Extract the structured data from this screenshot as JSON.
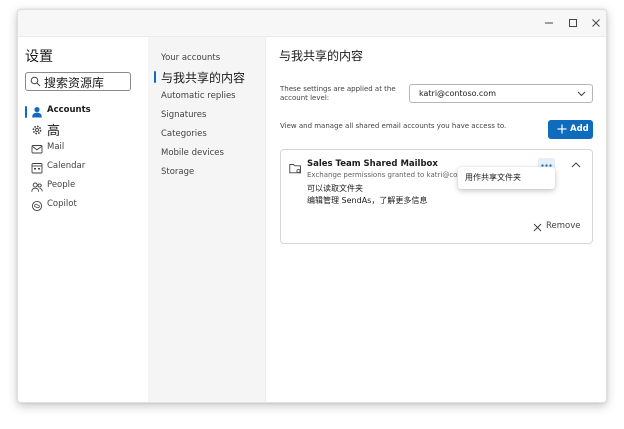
{
  "sidebar": {
    "title": "设置",
    "search": {
      "value": "搜索资源库"
    },
    "items": [
      {
        "label": "Accounts",
        "icon": "person-icon",
        "active": true
      },
      {
        "label": "高",
        "icon": "gear-icon"
      },
      {
        "label": "Mail",
        "icon": "mail-icon"
      },
      {
        "label": "Calendar",
        "icon": "calendar-icon"
      },
      {
        "label": "People",
        "icon": "people-icon"
      },
      {
        "label": "Copilot",
        "icon": "copilot-icon"
      }
    ]
  },
  "submenu": {
    "items": [
      {
        "label": "Your accounts"
      },
      {
        "label": "与我共享的内容",
        "active": true
      },
      {
        "label": "Automatic replies"
      },
      {
        "label": "Signatures"
      },
      {
        "label": "Categories"
      },
      {
        "label": "Mobile devices"
      },
      {
        "label": "Storage"
      }
    ]
  },
  "main": {
    "title": "与我共享的内容",
    "level_text": "These settings are applied at the account level:",
    "account_value": "katri@contoso.com",
    "manage_text": "View and manage all shared email accounts you have access to.",
    "add_label": "Add",
    "mailbox": {
      "name": "Sales Team Shared Mailbox",
      "desc": "Exchange permissions granted to katri@contoso.com",
      "perm1": "可以读取文件夹",
      "perm2": "编辑管理 SendAs，了解更多信息",
      "remove_label": "Remove"
    },
    "menu": {
      "item": "用作共享文件夹"
    }
  },
  "colors": {
    "accent": "#0f6cbd"
  }
}
